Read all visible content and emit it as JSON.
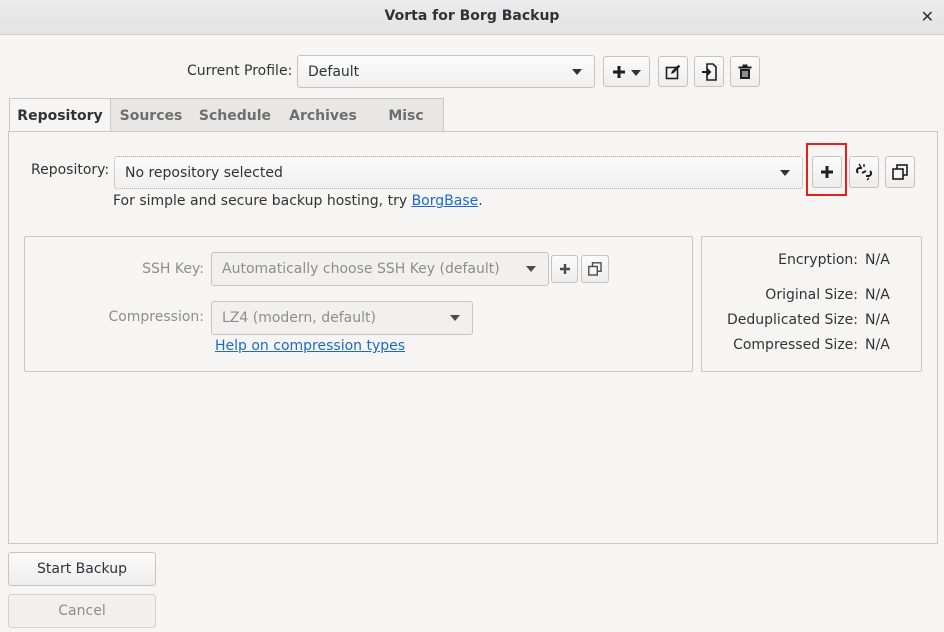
{
  "window": {
    "title": "Vorta for Borg Backup"
  },
  "profile": {
    "label": "Current Profile:",
    "selected": "Default"
  },
  "tabs": [
    {
      "label": "Repository"
    },
    {
      "label": "Sources"
    },
    {
      "label": "Schedule"
    },
    {
      "label": "Archives"
    },
    {
      "label": "Misc"
    }
  ],
  "repository": {
    "label": "Repository:",
    "selected": "No repository selected",
    "hint_prefix": "For simple and secure backup hosting, try ",
    "hint_link": "BorgBase",
    "hint_suffix": "."
  },
  "ssh": {
    "label": "SSH Key:",
    "selected": "Automatically choose SSH Key (default)"
  },
  "compression": {
    "label": "Compression:",
    "selected": "LZ4 (modern, default)",
    "help_link": "Help on compression types"
  },
  "stats": {
    "encryption_label": "Encryption:",
    "encryption_value": "N/A",
    "original_label": "Original Size:",
    "original_value": "N/A",
    "dedup_label": "Deduplicated Size:",
    "dedup_value": "N/A",
    "compressed_label": "Compressed Size:",
    "compressed_value": "N/A"
  },
  "actions": {
    "start_label": "Start Backup",
    "cancel_label": "Cancel"
  }
}
